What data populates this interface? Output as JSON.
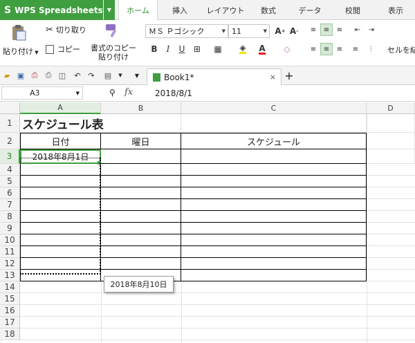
{
  "app": {
    "name": "WPS Spreadsheets",
    "logo_glyph": "S",
    "brand_color": "#3f9e3f"
  },
  "menu_tabs": [
    "ホーム",
    "挿入",
    "レイアウト",
    "数式",
    "データ",
    "校閲",
    "表示"
  ],
  "ribbon": {
    "paste_label": "貼り付け",
    "cut_label": "切り取り",
    "copy_label": "コピー",
    "format_painter_line1": "書式のコピー",
    "format_painter_line2": "貼り付け",
    "font_name": "ＭＳ Ｐゴシック",
    "font_size": "11",
    "wrap_label": "セルを結"
  },
  "doc_tab": {
    "name": "Book1*",
    "close": "×",
    "add": "+"
  },
  "formula_bar": {
    "cell_ref": "A3",
    "fx": "fx",
    "value": "2018/8/1"
  },
  "columns": [
    "A",
    "B",
    "C",
    "D"
  ],
  "rows": [
    "1",
    "2",
    "3",
    "4",
    "5",
    "6",
    "7",
    "8",
    "9",
    "10",
    "11",
    "12",
    "13",
    "14",
    "15",
    "16",
    "17",
    "18"
  ],
  "sheet": {
    "title": "スケジュール表",
    "header_date": "日付",
    "header_day": "曜日",
    "header_schedule": "スケジュール",
    "a3_value": "2018年8月1日"
  },
  "fill_tooltip": "2018年8月10日"
}
